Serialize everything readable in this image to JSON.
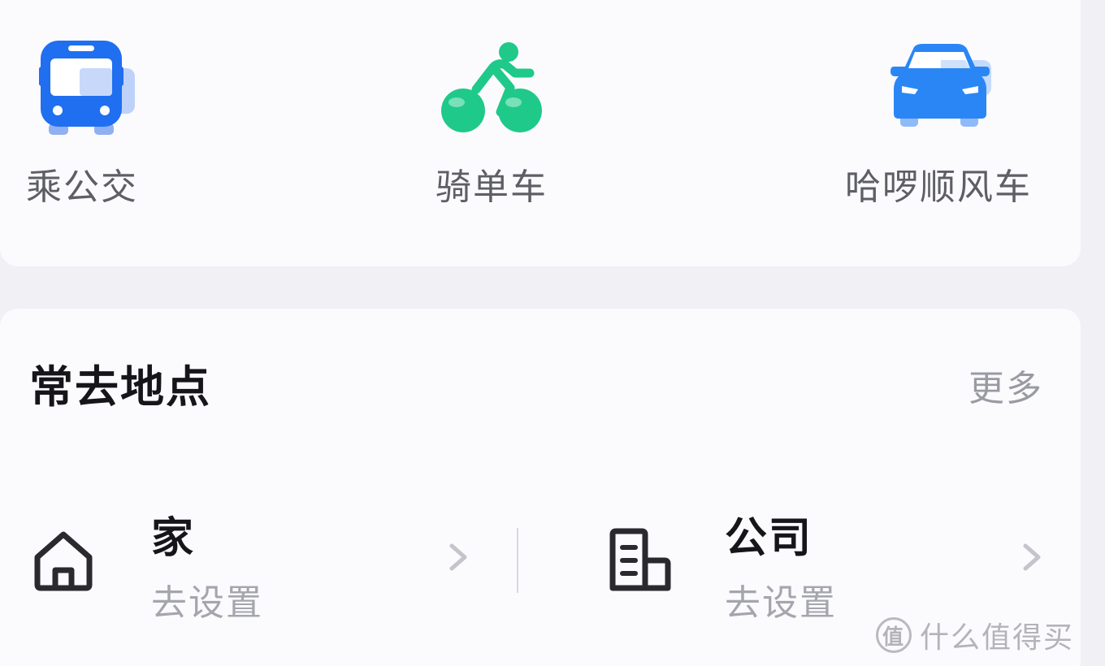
{
  "transport": [
    {
      "label": "乘公交",
      "icon": "bus-icon"
    },
    {
      "label": "骑单车",
      "icon": "bike-icon"
    },
    {
      "label": "哈啰顺风车",
      "icon": "car-icon"
    }
  ],
  "frequent_places": {
    "title": "常去地点",
    "more_label": "更多",
    "items": [
      {
        "name": "家",
        "subtitle": "去设置",
        "icon": "home-icon"
      },
      {
        "name": "公司",
        "subtitle": "去设置",
        "icon": "office-building-icon"
      }
    ]
  },
  "watermark": {
    "text": "什么值得买",
    "logo_char": "值"
  },
  "colors": {
    "bus_blue": "#1f6ff0",
    "bike_green": "#1fc98a",
    "car_blue": "#2a86f5",
    "text_dark": "#16161a",
    "text_gray": "#5e5e66",
    "text_light": "#a5a5ae"
  }
}
